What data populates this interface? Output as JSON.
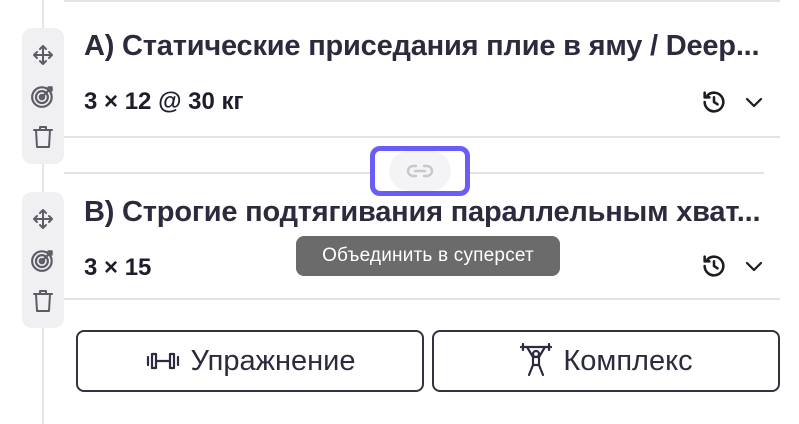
{
  "exercises": [
    {
      "title": "A) Статические приседания плие в яму / Deep...",
      "sets": "3 × 12 @ 30 кг"
    },
    {
      "title": "B) Строгие подтягивания параллельным хват...",
      "sets": "3 × 15"
    }
  ],
  "superset": {
    "tooltip": "Объединить в суперсет"
  },
  "buttons": {
    "exercise_label": "Упражнение",
    "complex_label": "Комплекс"
  },
  "colors": {
    "accent": "#6a5cf6",
    "tooltip_bg": "#6b6b6b",
    "text": "#2d2a3e"
  },
  "icons": [
    "move-icon",
    "target-icon",
    "trash-icon",
    "history-icon",
    "chevron-down-icon",
    "link-icon",
    "dumbbell-icon",
    "weightlifter-icon"
  ]
}
